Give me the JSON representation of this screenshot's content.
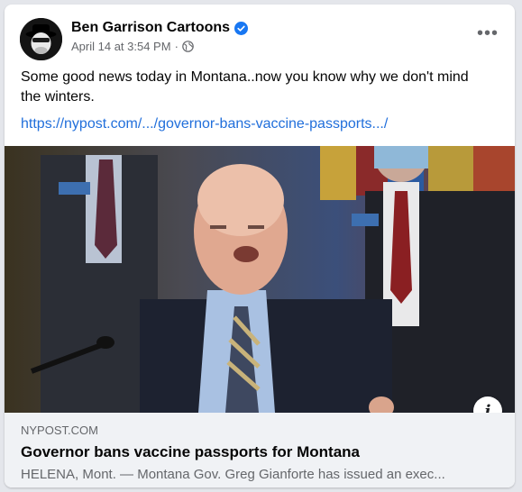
{
  "post": {
    "author": "Ben Garrison Cartoons",
    "timestamp": "April 14 at 3:54 PM",
    "separator": "·",
    "audience_icon": "globe-icon",
    "verified_icon": "verified-badge-icon",
    "more_label": "•••",
    "text": "Some good news today in Montana..now you know why we don't mind the winters.",
    "link": "https://nypost.com/.../governor-bans-vaccine-passports.../"
  },
  "link_preview": {
    "domain": "NYPOST.COM",
    "title": "Governor bans vaccine passports for Montana",
    "description": "HELENA, Mont. — Montana Gov. Greg Gianforte has issued an exec...",
    "info_label": "i"
  },
  "colors": {
    "link": "#216fdb",
    "verified": "#1877f2",
    "secondary_text": "#65676b",
    "footer_bg": "#f0f2f5"
  }
}
